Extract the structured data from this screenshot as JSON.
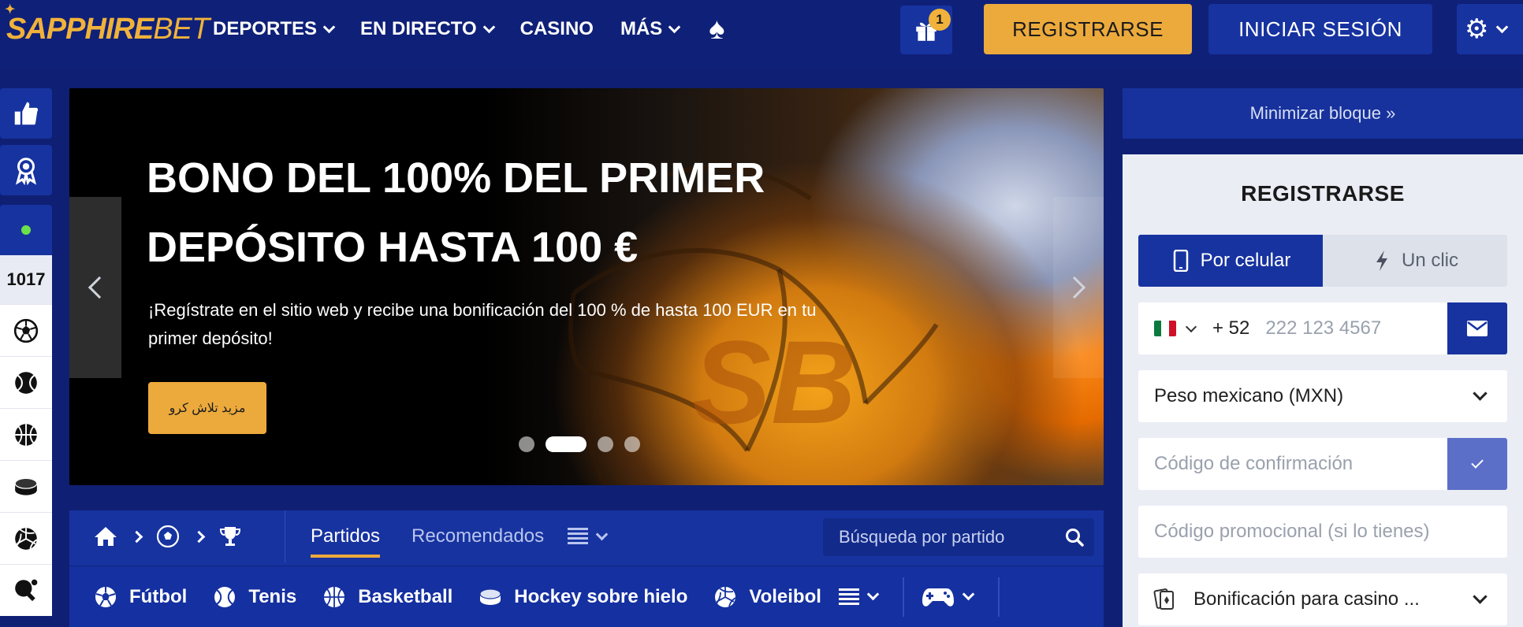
{
  "header": {
    "logo_main": "SAPPHIRE",
    "logo_accent": "BET",
    "nav": [
      {
        "label": "DEPORTES",
        "has_dropdown": true
      },
      {
        "label": "EN DIRECTO",
        "has_dropdown": true
      },
      {
        "label": "CASINO",
        "has_dropdown": false
      },
      {
        "label": "MÁS",
        "has_dropdown": true
      }
    ],
    "gift_badge": "1",
    "register_label": "REGISTRARSE",
    "login_label": "INICIAR SESIÓN",
    "accent_color": "#ecaa3c",
    "primary_color": "#1733a0"
  },
  "sidebar": {
    "live_count": "1017",
    "icons": [
      "thumbs-up-icon",
      "award-icon",
      "live-dot-icon",
      "soccer-ball-icon",
      "tennis-ball-icon",
      "basketball-icon",
      "hockey-puck-icon",
      "volleyball-icon",
      "table-tennis-icon"
    ]
  },
  "banner": {
    "title_line1": "BONO DEL 100% DEL PRIMER",
    "title_line2": "DEPÓSITO HASTA 100 €",
    "subtitle": "¡Regístrate en el sitio web y recibe una bonificación del 100 % de hasta 100 EUR en tu primer depósito!",
    "cta_label": "مزید تلاش کرو",
    "watermark": "SB",
    "slides": 4,
    "active_slide": 2
  },
  "sports_nav": {
    "tabs": [
      {
        "label": "Partidos",
        "active": true
      },
      {
        "label": "Recomendados",
        "active": false
      }
    ],
    "search_placeholder": "Búsqueda por partido",
    "sports": [
      {
        "label": "Fútbol",
        "icon": "soccer-ball-icon"
      },
      {
        "label": "Tenis",
        "icon": "tennis-ball-icon"
      },
      {
        "label": "Basketball",
        "icon": "basketball-icon"
      },
      {
        "label": "Hockey sobre hielo",
        "icon": "hockey-puck-icon"
      },
      {
        "label": "Voleibol",
        "icon": "volleyball-icon"
      }
    ]
  },
  "register_panel": {
    "minimize_label": "Minimizar bloque »",
    "title": "REGISTRARSE",
    "tab_phone": "Por celular",
    "tab_oneclick": "Un clic",
    "phone_prefix": "+ 52",
    "phone_placeholder": "222 123 4567",
    "currency": "Peso mexicano (MXN)",
    "confirmation_placeholder": "Código de confirmación",
    "promo_placeholder": "Código promocional (si lo tienes)",
    "bonus_label": "Bonificación para casino ..."
  }
}
